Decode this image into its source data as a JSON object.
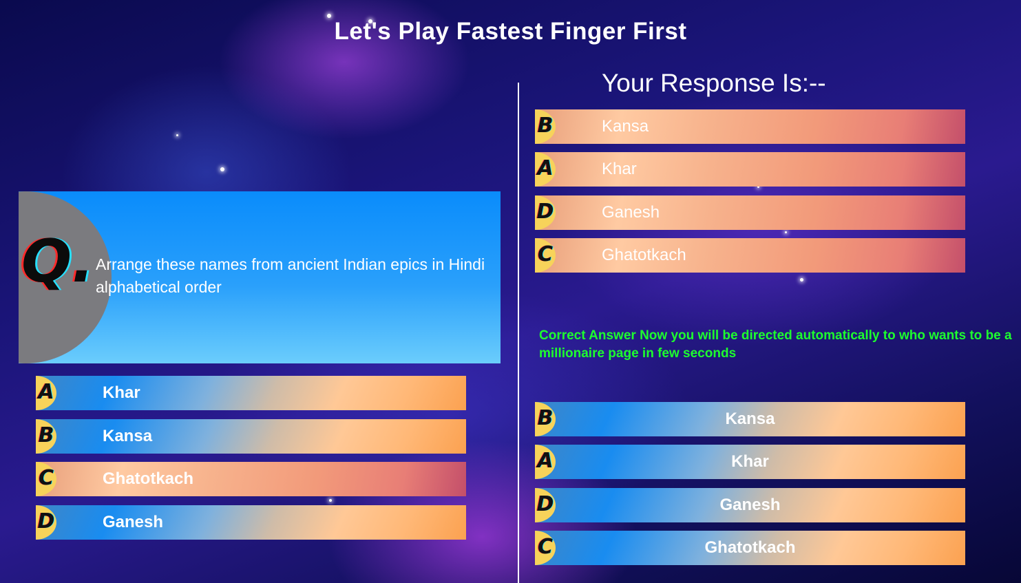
{
  "title": "Let's Play Fastest Finger First",
  "question": {
    "marker": "Q.",
    "text": "Arrange these names from ancient Indian epics in Hindi alphabetical order"
  },
  "options": [
    {
      "letter": "A",
      "label": "Khar",
      "selected": false
    },
    {
      "letter": "B",
      "label": "Kansa",
      "selected": false
    },
    {
      "letter": "C",
      "label": "Ghatotkach",
      "selected": true
    },
    {
      "letter": "D",
      "label": "Ganesh",
      "selected": false
    }
  ],
  "response": {
    "heading": "Your Response Is:--",
    "items": [
      {
        "letter": "B",
        "label": "Kansa"
      },
      {
        "letter": "A",
        "label": "Khar"
      },
      {
        "letter": "D",
        "label": "Ganesh"
      },
      {
        "letter": "C",
        "label": "Ghatotkach"
      }
    ]
  },
  "message": "Correct Answer Now you will be directed automatically to who wants to be a millionaire page in few seconds",
  "correct_order": [
    {
      "letter": "B",
      "label": "Kansa"
    },
    {
      "letter": "A",
      "label": "Khar"
    },
    {
      "letter": "D",
      "label": "Ganesh"
    },
    {
      "letter": "C",
      "label": "Ghatotkach"
    }
  ],
  "colors": {
    "message": "#1dff2e",
    "badge": "#f7d35a",
    "question_box": "#0a8cfb"
  }
}
